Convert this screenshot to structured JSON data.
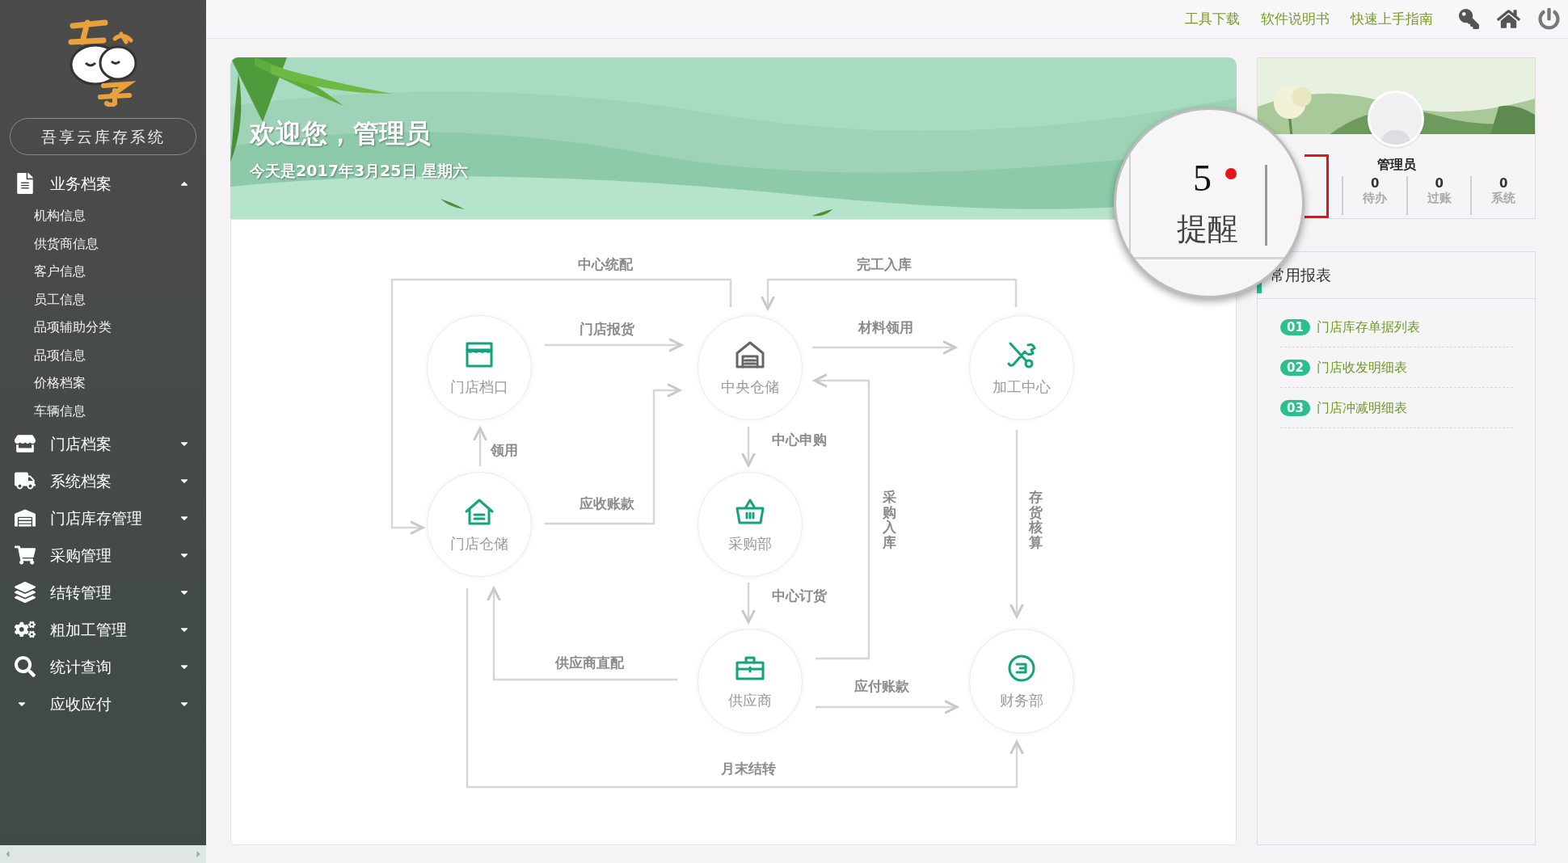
{
  "sidebar": {
    "logo_text": "吾享云库存系统",
    "menu": [
      {
        "label": "业务档案",
        "expanded": true,
        "children": [
          "机构信息",
          "供货商信息",
          "客户信息",
          "员工信息",
          "品项辅助分类",
          "品项信息",
          "价格档案",
          "车辆信息"
        ]
      },
      {
        "label": "门店档案",
        "expanded": false
      },
      {
        "label": "系统档案",
        "expanded": false
      },
      {
        "label": "门店库存管理",
        "expanded": false
      },
      {
        "label": "采购管理",
        "expanded": false
      },
      {
        "label": "结转管理",
        "expanded": false
      },
      {
        "label": "粗加工管理",
        "expanded": false
      },
      {
        "label": "统计查询",
        "expanded": false
      },
      {
        "label": "应收应付",
        "expanded": false
      }
    ]
  },
  "top_bar": {
    "links": [
      "工具下载",
      "软件说明书",
      "快速上手指南"
    ]
  },
  "banner": {
    "title": "欢迎您，管理员",
    "date": "今天是2017年3月25日 星期六"
  },
  "flow": {
    "nodes": [
      "门店档口",
      "中央仓储",
      "加工中心",
      "门店仓储",
      "采购部",
      "供应商",
      "财务部"
    ],
    "edges": [
      "中心统配",
      "完工入库",
      "门店报货",
      "材料领用",
      "领用",
      "应收账款",
      "中心申购",
      "采购入库",
      "存货核算",
      "中心订货",
      "供应商直配",
      "应付账款",
      "月末结转"
    ]
  },
  "profile": {
    "name": "管理员",
    "stats": [
      {
        "value": "5",
        "label": "提醒",
        "alert": true,
        "highlighted": true
      },
      {
        "value": "0",
        "label": "待办",
        "alert": false,
        "highlighted": false
      },
      {
        "value": "0",
        "label": "过账",
        "alert": false,
        "highlighted": false
      },
      {
        "value": "0",
        "label": "系统",
        "alert": false,
        "highlighted": false
      }
    ]
  },
  "reports": {
    "title": "常用报表",
    "items": [
      {
        "number": "01",
        "label": "门店库存单据列表"
      },
      {
        "number": "02",
        "label": "门店收发明细表"
      },
      {
        "number": "03",
        "label": "门店冲减明细表"
      }
    ]
  }
}
